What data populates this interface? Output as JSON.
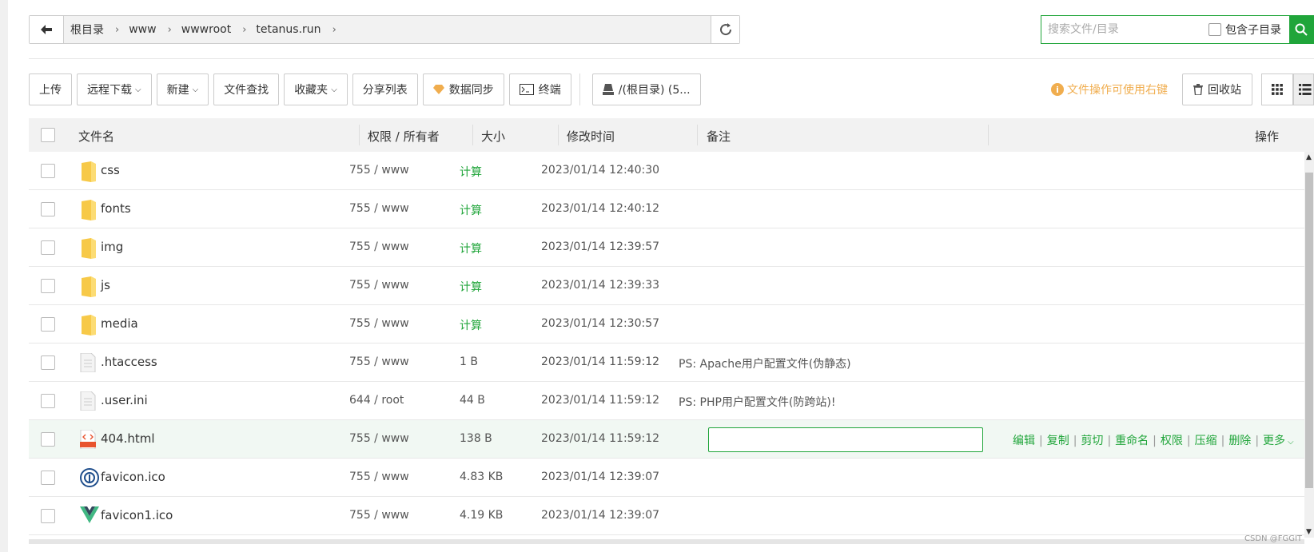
{
  "breadcrumb": {
    "items": [
      "根目录",
      "www",
      "wwwroot",
      "tetanus.run"
    ]
  },
  "search": {
    "placeholder": "搜索文件/目录",
    "subdir_label": "包含子目录"
  },
  "toolbar": {
    "upload": "上传",
    "remote_download": "远程下载",
    "new": "新建",
    "file_search": "文件查找",
    "favorites": "收藏夹",
    "share_list": "分享列表",
    "data_sync": "数据同步",
    "terminal": "终端",
    "disk": "/(根目录) (5..."
  },
  "tip": "文件操作可使用右键",
  "recycle": "回收站",
  "table": {
    "headers": {
      "name": "文件名",
      "perm": "权限 / 所有者",
      "size": "大小",
      "mtime": "修改时间",
      "note": "备注",
      "ops": "操作"
    },
    "rows": [
      {
        "name": "css",
        "type": "folder",
        "perm": "755 / www",
        "size": "计算",
        "mtime": "2023/01/14 12:40:30",
        "note": ""
      },
      {
        "name": "fonts",
        "type": "folder",
        "perm": "755 / www",
        "size": "计算",
        "mtime": "2023/01/14 12:40:12",
        "note": ""
      },
      {
        "name": "img",
        "type": "folder",
        "perm": "755 / www",
        "size": "计算",
        "mtime": "2023/01/14 12:39:57",
        "note": ""
      },
      {
        "name": "js",
        "type": "folder",
        "perm": "755 / www",
        "size": "计算",
        "mtime": "2023/01/14 12:39:33",
        "note": ""
      },
      {
        "name": "media",
        "type": "folder",
        "perm": "755 / www",
        "size": "计算",
        "mtime": "2023/01/14 12:30:57",
        "note": ""
      },
      {
        "name": ".htaccess",
        "type": "file",
        "perm": "755 / www",
        "size": "1 B",
        "mtime": "2023/01/14 11:59:12",
        "note": "PS: Apache用户配置文件(伪静态)"
      },
      {
        "name": ".user.ini",
        "type": "file",
        "perm": "644 / root",
        "size": "44 B",
        "mtime": "2023/01/14 11:59:12",
        "note": "PS: PHP用户配置文件(防跨站)!"
      },
      {
        "name": "404.html",
        "type": "html",
        "perm": "755 / www",
        "size": "138 B",
        "mtime": "2023/01/14 11:59:12",
        "note": ""
      },
      {
        "name": "favicon.ico",
        "type": "ico",
        "perm": "755 / www",
        "size": "4.83 KB",
        "mtime": "2023/01/14 12:39:07",
        "note": ""
      },
      {
        "name": "favicon1.ico",
        "type": "vue",
        "perm": "755 / www",
        "size": "4.19 KB",
        "mtime": "2023/01/14 12:39:07",
        "note": ""
      }
    ]
  },
  "row_ops": [
    "编辑",
    "复制",
    "剪切",
    "重命名",
    "权限",
    "压缩",
    "删除",
    "更多"
  ],
  "watermark": "CSDN @FGGIT",
  "colors": {
    "accent": "#20a53a",
    "warning": "#f0ad4e"
  }
}
